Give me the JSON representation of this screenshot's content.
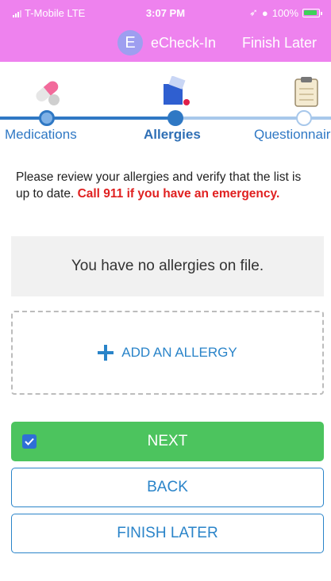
{
  "status_bar": {
    "carrier": "T-Mobile  LTE",
    "time": "3:07 PM",
    "battery_text": "100%"
  },
  "app_bar": {
    "avatar_letter": "E",
    "title": "eCheck-In",
    "finish_later": "Finish Later"
  },
  "stepper": {
    "steps": [
      {
        "label": "Medications",
        "state": "done",
        "icon": "pills-icon"
      },
      {
        "label": "Allergies",
        "state": "current",
        "icon": "allergy-icon"
      },
      {
        "label": "Questionnaire",
        "state": "todo",
        "icon": "clipboard-icon"
      }
    ]
  },
  "content": {
    "intro_text": "Please review your allergies and verify that the list is up to date. ",
    "intro_warning": "Call 911 if you have an emergency.",
    "empty_message": "You have no allergies on file.",
    "add_label": "ADD AN ALLERGY"
  },
  "buttons": {
    "next": "NEXT",
    "back": "BACK",
    "finish_later": "FINISH LATER"
  },
  "colors": {
    "header": "#ee82ee",
    "primary": "#2f78c4",
    "next_button": "#4cc45e",
    "warning": "#e02020"
  }
}
